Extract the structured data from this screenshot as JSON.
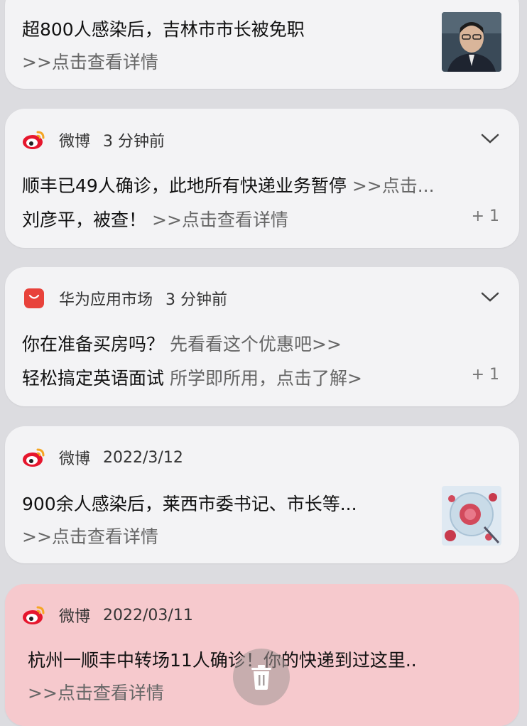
{
  "notifications": [
    {
      "title": "超800人感染后，吉林市市长被免职",
      "detail": ">>点击查看详情"
    },
    {
      "app": "微博",
      "time": "3 分钟前",
      "line1_title": "顺丰已49人确诊，此地所有快递业务暂停",
      "line1_sub": ">>点击...",
      "line2_title": "刘彦平，被查！",
      "line2_sub": ">>点击查看详情",
      "count": "+ 1"
    },
    {
      "app": "华为应用市场",
      "time": "3 分钟前",
      "line1_title": "你在准备买房吗？",
      "line1_sub": "先看看这个优惠吧>>",
      "line2_title": "轻松搞定英语面试",
      "line2_sub": "所学即所用，点击了解>",
      "count": "+ 1"
    },
    {
      "app": "微博",
      "time": "2022/3/12",
      "title": "900余人感染后，莱西市委书记、市长等...",
      "detail": ">>点击查看详情"
    },
    {
      "app": "微博",
      "time": "2022/03/11",
      "title": "杭州一顺丰中转场11人确诊！你的快递到过这里..",
      "detail": ">>点击查看详情"
    }
  ],
  "colors": {
    "weibo_red": "#e6162d",
    "weibo_yellow": "#f5a623",
    "huawei_red": "#e8423b",
    "highlight_card": "#f6c9cd"
  },
  "icons": [
    "weibo-icon",
    "huawei-appgallery-icon",
    "chevron-down-icon",
    "trash-icon"
  ]
}
